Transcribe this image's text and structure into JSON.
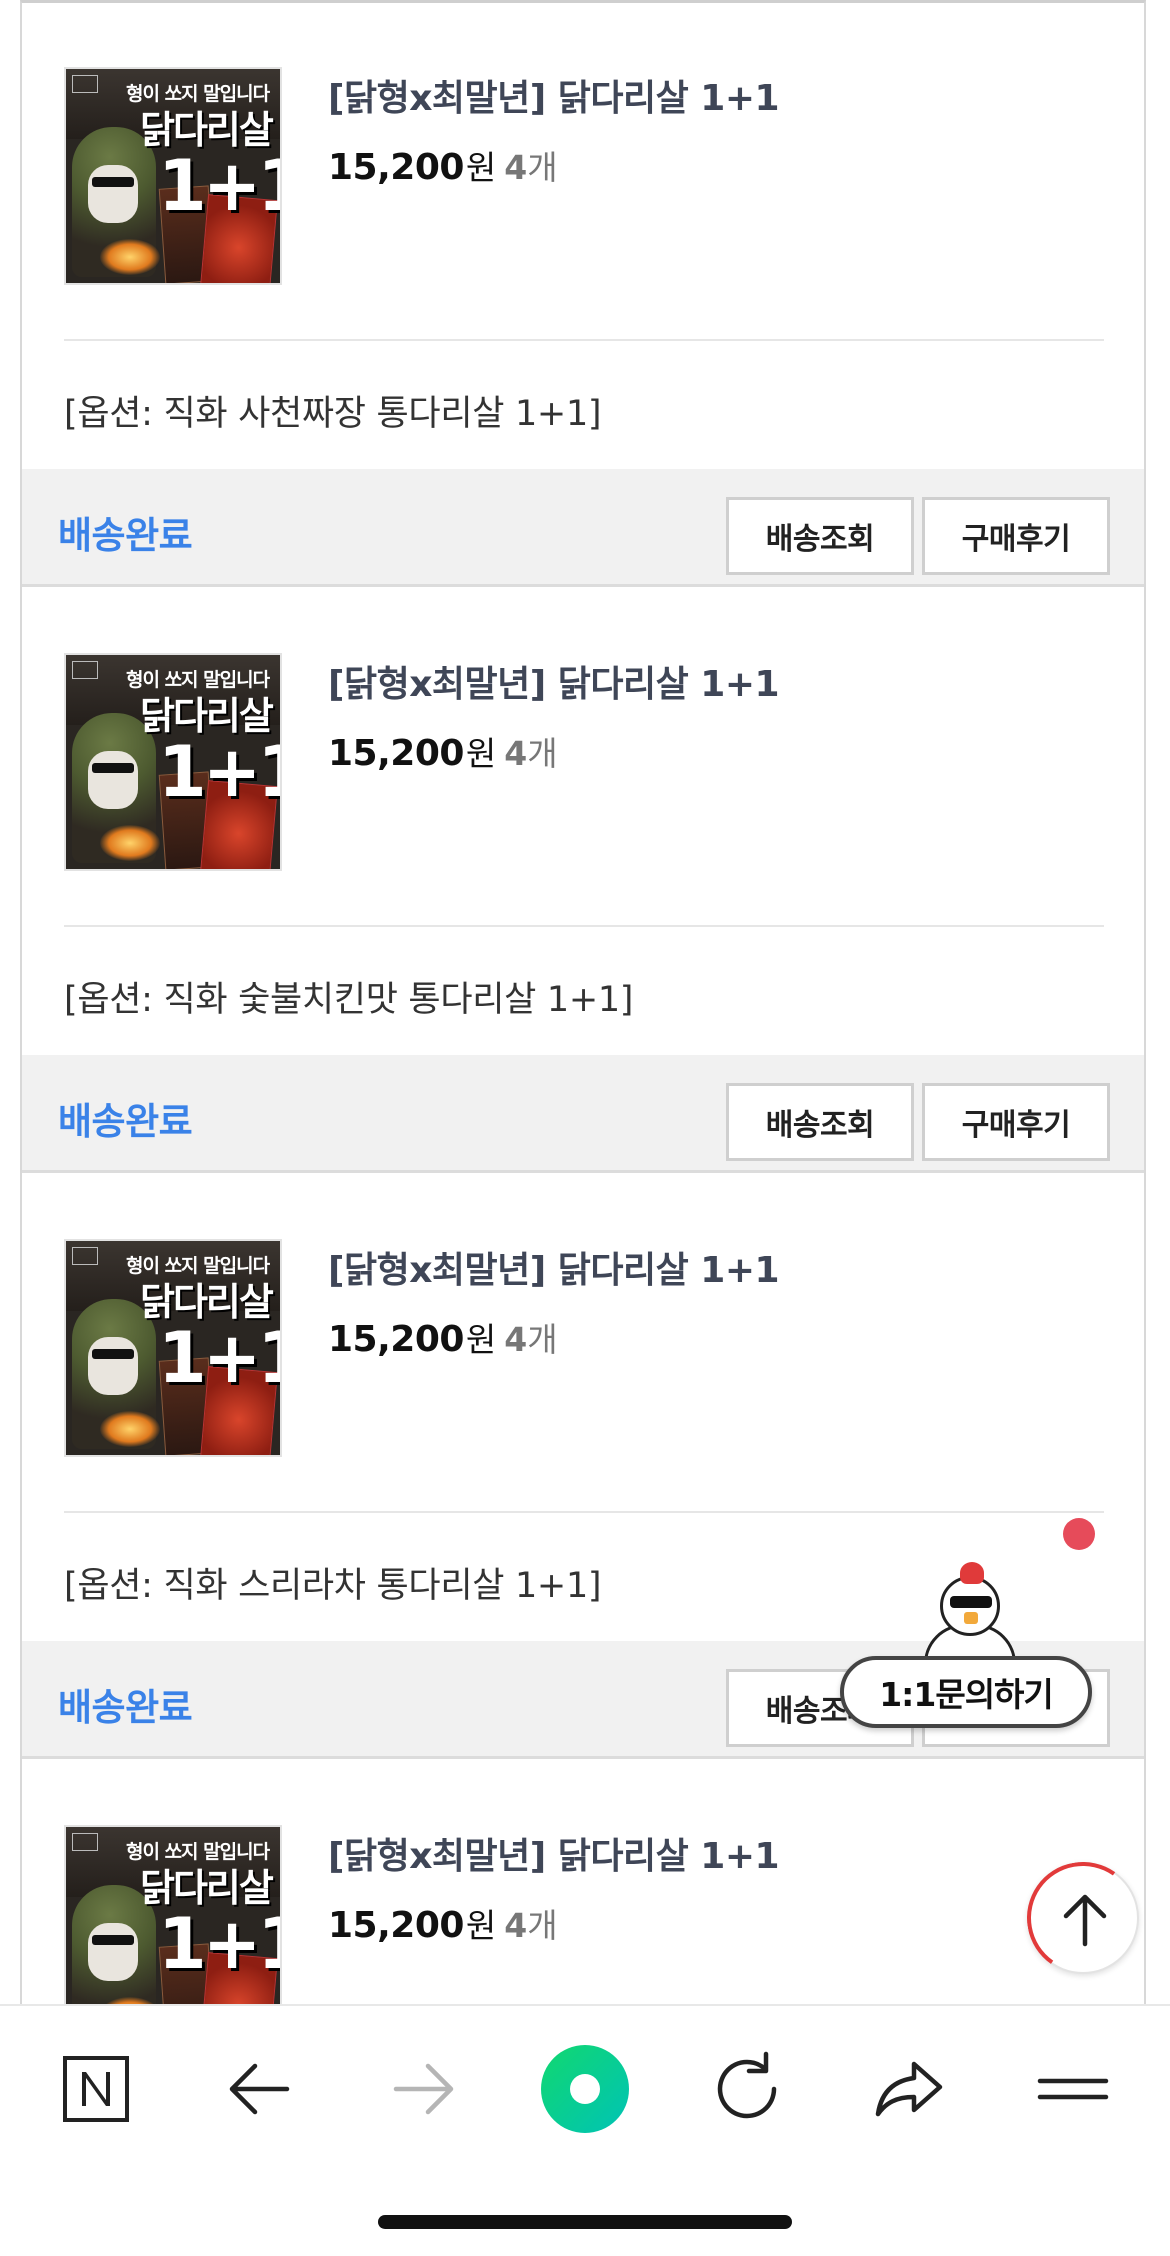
{
  "orders": [
    {
      "product_title": "[닭형x최말년] 닭다리살 1+1",
      "price": "15,200",
      "currency": "원",
      "quantity_number": "4",
      "quantity_unit": "개",
      "option": "[옵션: 직화 사천짜장 통다리살 1+1]",
      "status": "배송완료",
      "track_label": "배송조회",
      "review_label": "구매후기",
      "thumbnail": {
        "headline": "형이 쏘지 말입니다",
        "big": "닭다리살",
        "plus": "1+1"
      }
    },
    {
      "product_title": "[닭형x최말년] 닭다리살 1+1",
      "price": "15,200",
      "currency": "원",
      "quantity_number": "4",
      "quantity_unit": "개",
      "option": "[옵션: 직화 숯불치킨맛 통다리살 1+1]",
      "status": "배송완료",
      "track_label": "배송조회",
      "review_label": "구매후기",
      "thumbnail": {
        "headline": "형이 쏘지 말입니다",
        "big": "닭다리살",
        "plus": "1+1"
      }
    },
    {
      "product_title": "[닭형x최말년] 닭다리살 1+1",
      "price": "15,200",
      "currency": "원",
      "quantity_number": "4",
      "quantity_unit": "개",
      "option": "[옵션: 직화 스리라차 통다리살 1+1]",
      "status": "배송완료",
      "track_label": "배송조회",
      "review_label": "구매후기",
      "thumbnail": {
        "headline": "형이 쏘지 말입니다",
        "big": "닭다리살",
        "plus": "1+1"
      }
    },
    {
      "product_title": "[닭형x최말년] 닭다리살 1+1",
      "price": "15,200",
      "currency": "원",
      "quantity_number": "4",
      "quantity_unit": "개",
      "thumbnail": {
        "headline": "형이 쏘지 말입니다",
        "big": "닭다리살",
        "plus": "1+1"
      }
    }
  ],
  "floating": {
    "chat_label": "1:1문의하기",
    "chat_mascot_icon": "chicken-mascot-icon",
    "notification_color": "#e64b5a",
    "scroll_top_icon": "arrow-up-icon"
  },
  "browser_toolbar": {
    "icons": [
      "naver-n-icon",
      "back-arrow-icon",
      "forward-arrow-icon",
      "green-dot-icon",
      "refresh-icon",
      "share-icon",
      "menu-icon"
    ]
  },
  "colors": {
    "status_blue": "#3a82e8",
    "title_gray": "#3f4657",
    "naver_green": "#03cf5d"
  }
}
